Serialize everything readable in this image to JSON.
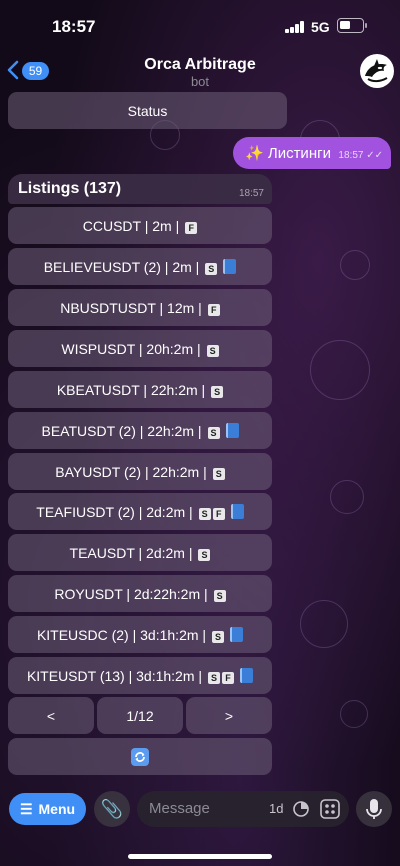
{
  "status_bar": {
    "time": "18:57",
    "network": "5G"
  },
  "header": {
    "back_badge": "59",
    "title": "Orca Arbitrage",
    "subtitle": "bot"
  },
  "top_button": {
    "label": "Status"
  },
  "outgoing_message": {
    "text": "✨ Листинги",
    "time": "18:57"
  },
  "incoming_message": {
    "text": "Listings (137)",
    "time": "18:57"
  },
  "listing_buttons": [
    {
      "text": "CCUSDT | 2m |",
      "tags": [
        "F"
      ],
      "book": false
    },
    {
      "text": "BELIEVEUSDT (2) | 2m |",
      "tags": [
        "S"
      ],
      "book": true
    },
    {
      "text": "NBUSDTUSDT | 12m |",
      "tags": [
        "F"
      ],
      "book": false
    },
    {
      "text": "WISPUSDT | 20h:2m |",
      "tags": [
        "S"
      ],
      "book": false
    },
    {
      "text": "KBEATUSDT | 22h:2m |",
      "tags": [
        "S"
      ],
      "book": false
    },
    {
      "text": "BEATUSDT (2) | 22h:2m |",
      "tags": [
        "S"
      ],
      "book": true
    },
    {
      "text": "BAYUSDT (2) | 22h:2m |",
      "tags": [
        "S"
      ],
      "book": false
    },
    {
      "text": "TEAFIUSDT (2) | 2d:2m |",
      "tags": [
        "S",
        "F"
      ],
      "book": true
    },
    {
      "text": "TEAUSDT | 2d:2m |",
      "tags": [
        "S"
      ],
      "book": false
    },
    {
      "text": "ROYUSDT | 2d:22h:2m |",
      "tags": [
        "S"
      ],
      "book": false
    },
    {
      "text": "KITEUSDC (2) | 3d:1h:2m |",
      "tags": [
        "S"
      ],
      "book": true
    },
    {
      "text": "KITEUSDT (13) | 3d:1h:2m |",
      "tags": [
        "S",
        "F"
      ],
      "book": true
    }
  ],
  "pagination": {
    "prev": "<",
    "page": "1/12",
    "next": ">"
  },
  "refresh_icon": "refresh-icon",
  "bottom_bar": {
    "menu_label": "Menu",
    "input_placeholder": "Message",
    "schedule_label": "1d"
  },
  "colors": {
    "accent": "#3f8ff7",
    "outgoing_bubble": "#a153e0"
  }
}
